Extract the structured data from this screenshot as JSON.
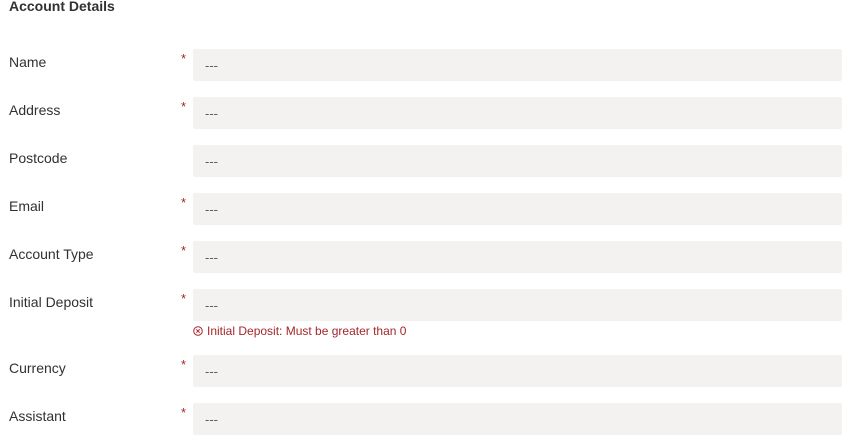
{
  "form": {
    "title": "Account Details",
    "required_marker": "*",
    "fields": [
      {
        "label": "Name",
        "required": true,
        "placeholder": "---"
      },
      {
        "label": "Address",
        "required": true,
        "placeholder": "---"
      },
      {
        "label": "Postcode",
        "required": false,
        "placeholder": "---"
      },
      {
        "label": "Email",
        "required": true,
        "placeholder": "---"
      },
      {
        "label": "Account Type",
        "required": true,
        "placeholder": "---"
      },
      {
        "label": "Initial Deposit",
        "required": true,
        "placeholder": "---",
        "error": "Initial Deposit: Must be greater than 0"
      },
      {
        "label": "Currency",
        "required": true,
        "placeholder": "---"
      },
      {
        "label": "Assistant",
        "required": true,
        "placeholder": "---"
      }
    ]
  },
  "colors": {
    "error": "#a4262c",
    "field_background": "#f3f2f1"
  },
  "icons": {
    "error": "error-circle-icon"
  }
}
